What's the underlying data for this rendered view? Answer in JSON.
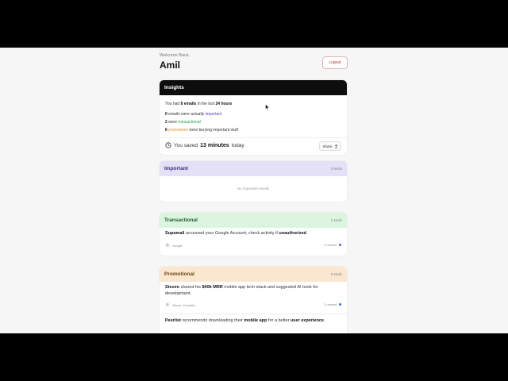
{
  "header": {
    "welcome": "Welcome Back,",
    "name": "Amil",
    "logout_label": "Logout"
  },
  "insights": {
    "title": "Insights",
    "summary": {
      "pre": "You had ",
      "emails": "8 emails",
      "mid": " in the last ",
      "period": "24 hours"
    },
    "important_line": {
      "count": "0",
      "mid": " emails were actually ",
      "word": "important"
    },
    "transactional_line": {
      "count": "2",
      "mid": " were ",
      "word": "transactional"
    },
    "promotional_line": {
      "count": "6",
      "word": "promotions",
      "post": " were burying important stuff"
    },
    "saved": {
      "pre": "You saved",
      "time": "13 minutes",
      "post": "today"
    },
    "share_label": "Share"
  },
  "important": {
    "title": "Important",
    "count": "0 Mails",
    "empty_text": "No important emails"
  },
  "transactional": {
    "title": "Transactional",
    "count": "2 Mails",
    "mails": [
      {
        "bold1": "Supamail",
        "text": " accessed your Google Account; check activity if ",
        "bold2": "unauthorized",
        "end": ".",
        "sender": "Google",
        "unread": "2 unread"
      }
    ]
  },
  "promotional": {
    "title": "Promotional",
    "count": "6 Mails",
    "mails": [
      {
        "bold1": "Steven",
        "text1": " shared his ",
        "bold2": "$40k MRR",
        "text2": " mobile app tech stack and suggested AI tools for development.",
        "sender": "Steven Cravotta",
        "unread": "2 unread"
      },
      {
        "bold1": "Peerlist",
        "text1": " recommends downloading their ",
        "bold2": "mobile app",
        "text2": " for a better ",
        "bold3": "user experience",
        "end": "."
      }
    ]
  },
  "colors": {
    "important_accent": "#5b3fc4",
    "transactional_accent": "#2e9e4d",
    "promotional_accent": "#e08a1e",
    "unread_dot": "#3b6fd8"
  }
}
